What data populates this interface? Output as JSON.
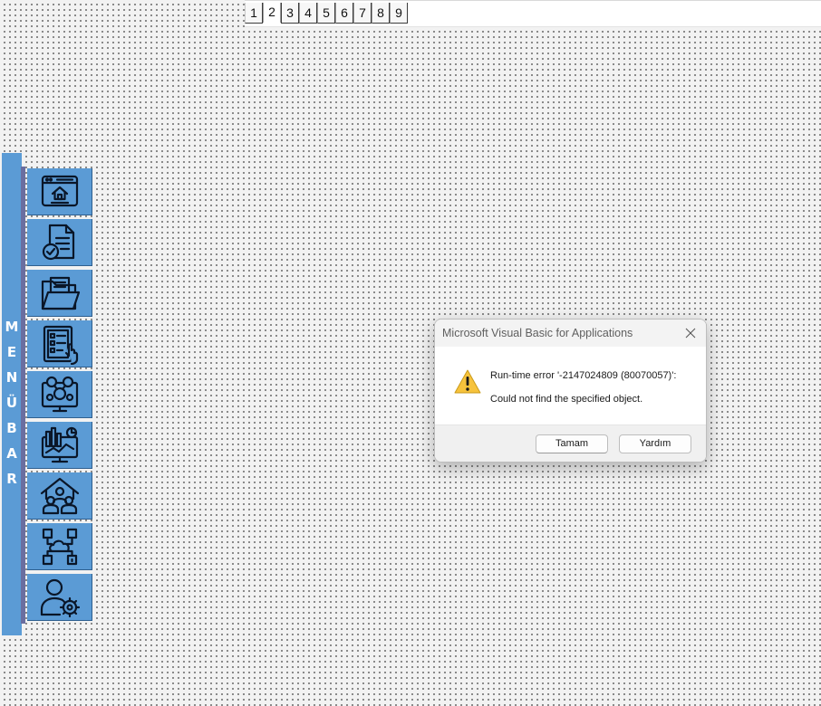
{
  "page_tabs": {
    "items": [
      "1",
      "2",
      "3",
      "4",
      "5",
      "6",
      "7",
      "8",
      "9"
    ],
    "active_index": 1
  },
  "menubar": {
    "label": "MENÜBAR",
    "color": "#5b9bd5",
    "items": [
      {
        "icon": "web-home-icon"
      },
      {
        "icon": "document-check-icon"
      },
      {
        "icon": "folder-documents-icon"
      },
      {
        "icon": "checklist-click-icon"
      },
      {
        "icon": "monitor-network-icon"
      },
      {
        "icon": "analytics-monitor-icon"
      },
      {
        "icon": "family-home-icon"
      },
      {
        "icon": "cloud-network-icon"
      },
      {
        "icon": "user-settings-icon"
      }
    ]
  },
  "dialog": {
    "title": "Microsoft Visual Basic for Applications",
    "close_icon": "close-icon",
    "warning_icon": "warning-icon",
    "message_line1": "Run-time error '-2147024809 (80070057)':",
    "message_line2": "Could not find the specified object.",
    "buttons": {
      "ok": "Tamam",
      "help": "Yardım"
    }
  }
}
